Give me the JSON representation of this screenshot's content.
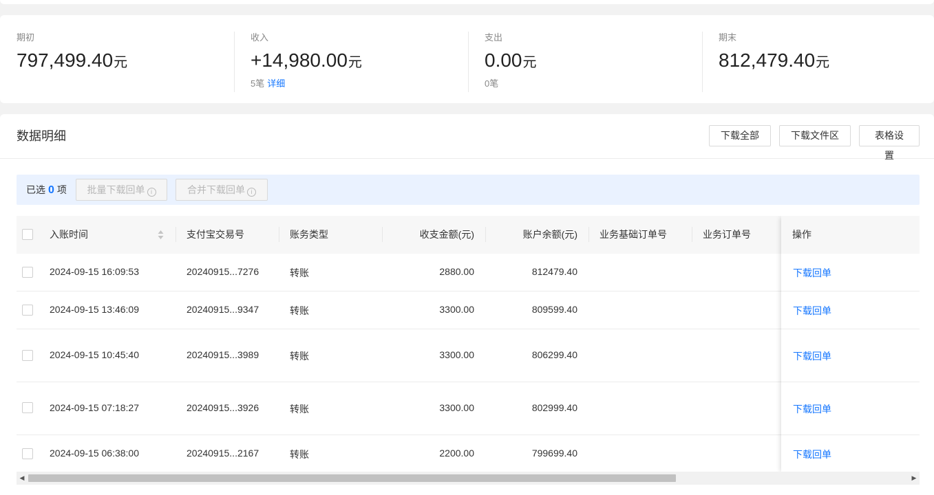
{
  "summary": {
    "opening": {
      "label": "期初",
      "value": "797,499.40",
      "unit": "元"
    },
    "income": {
      "label": "收入",
      "value": "+14,980.00",
      "unit": "元",
      "count": "5笔",
      "detail_link": "详细"
    },
    "expense": {
      "label": "支出",
      "value": "0.00",
      "unit": "元",
      "count": "0笔"
    },
    "closing": {
      "label": "期末",
      "value": "812,479.40",
      "unit": "元"
    }
  },
  "panel": {
    "title": "数据明细",
    "buttons": {
      "download_all": "下载全部",
      "download_area": "下载文件区",
      "table_settings": "表格设置"
    }
  },
  "selection": {
    "prefix": "已选",
    "count": "0",
    "suffix": "项",
    "batch_download": "批量下载回单",
    "merge_download": "合并下载回单",
    "info_glyph": "i"
  },
  "table": {
    "columns": {
      "time": "入账时间",
      "trade_no": "支付宝交易号",
      "type": "账务类型",
      "amount": "收支金额(元)",
      "balance": "账户余额(元)",
      "base_order": "业务基础订单号",
      "order": "业务订单号",
      "action": "操作"
    },
    "rows": [
      {
        "time": "2024-09-15 16:09:53",
        "trade_no": "20240915...7276",
        "type": "转账",
        "amount": "2880.00",
        "balance": "812479.40",
        "action": "下载回单"
      },
      {
        "time": "2024-09-15 13:46:09",
        "trade_no": "20240915...9347",
        "type": "转账",
        "amount": "3300.00",
        "balance": "809599.40",
        "action": "下载回单"
      },
      {
        "time": "2024-09-15 10:45:40",
        "trade_no": "20240915...3989",
        "type": "转账",
        "amount": "3300.00",
        "balance": "806299.40",
        "action": "下载回单"
      },
      {
        "time": "2024-09-15 07:18:27",
        "trade_no": "20240915...3926",
        "type": "转账",
        "amount": "3300.00",
        "balance": "802999.40",
        "action": "下载回单"
      },
      {
        "time": "2024-09-15 06:38:00",
        "trade_no": "20240915...2167",
        "type": "转账",
        "amount": "2200.00",
        "balance": "799699.40",
        "action": "下载回单"
      }
    ]
  },
  "icons": {
    "sort": "sort-icon",
    "info": "info-circle-icon",
    "scroll_left": "arrow-left-icon",
    "scroll_right": "arrow-right-icon"
  },
  "colors": {
    "link": "#1677ff",
    "selection_bg": "#eaf2ff"
  }
}
